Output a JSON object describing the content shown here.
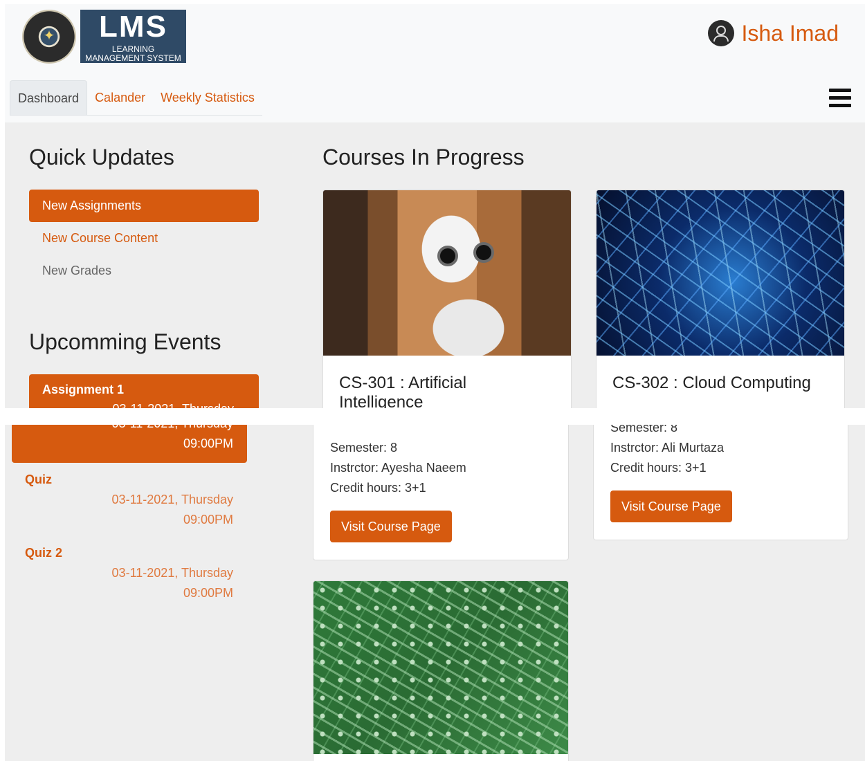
{
  "brand": {
    "logo_text": "LMS",
    "logo_sub1": "LEARNING",
    "logo_sub2": "MANAGEMENT SYSTEM",
    "seal_icon": "college-seal-icon"
  },
  "user": {
    "name": "Isha Imad",
    "icon": "user-circle-icon"
  },
  "nav": {
    "tabs": [
      {
        "label": "Dashboard",
        "active": true
      },
      {
        "label": "Calander"
      },
      {
        "label": "Weekly Statistics"
      }
    ],
    "menu_icon": "hamburger-menu-icon"
  },
  "quick_updates": {
    "title": "Quick Updates",
    "items": [
      {
        "label": "New Assignments",
        "active": true
      },
      {
        "label": "New Course Content"
      },
      {
        "label": "New Grades"
      }
    ]
  },
  "events": {
    "title": "Upcomming Events",
    "items": [
      {
        "title": "Assignment 1",
        "date": "03-11-2021, Thursday",
        "time": "09:00PM",
        "active": true
      },
      {
        "title": "Quiz",
        "date": "03-11-2021, Thursday",
        "time": "09:00PM"
      },
      {
        "title": "Quiz 2",
        "date": "03-11-2021, Thursday",
        "time": "09:00PM"
      }
    ]
  },
  "courses": {
    "title": "Courses In Progress",
    "button_label": "Visit Course Page",
    "list": [
      {
        "title_line1": "CS-301 : Artificial",
        "title_line2": "Intelligence",
        "semester": "Semester: 8",
        "instructor": "Instrctor: Ayesha Naeem",
        "credit": "Credit hours: 3+1",
        "image": "robot-photo"
      },
      {
        "title_line1": "CS-302 : Cloud Computing",
        "semester": "Semester: 8",
        "instructor": "Instrctor: Ali Murtaza",
        "credit": "Credit hours: 3+1",
        "image": "network-photo"
      },
      {
        "image": "circuit-board-photo"
      }
    ]
  },
  "colors": {
    "accent": "#d65a0f",
    "background": "#eeeeee",
    "header": "#f8f9fa"
  }
}
